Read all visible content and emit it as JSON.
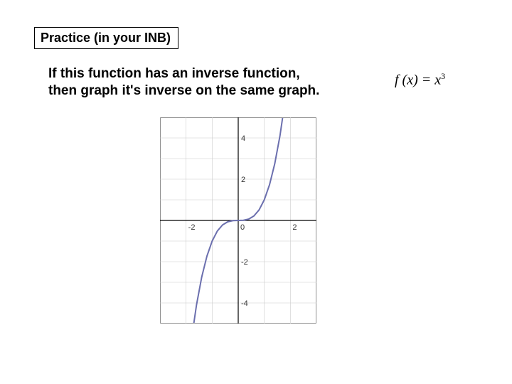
{
  "title": "Practice (in your INB)",
  "prompt_line1": "If this function has an inverse function,",
  "prompt_line2": "then graph it's inverse on the same graph.",
  "formula": {
    "lhs": "f (x)",
    "eq": " = ",
    "rhs_base": "x",
    "rhs_exp": "3"
  },
  "chart_data": {
    "type": "line",
    "title": "",
    "xlabel": "",
    "ylabel": "",
    "xlim": [
      -3,
      3
    ],
    "ylim": [
      -5,
      5
    ],
    "x_ticks": [
      -2,
      0,
      2
    ],
    "y_ticks": [
      -4,
      -2,
      2,
      4
    ],
    "grid": true,
    "series": [
      {
        "name": "f(x) = x^3",
        "color": "#6b6fae",
        "x": [
          -2.0,
          -1.8,
          -1.6,
          -1.4,
          -1.2,
          -1.0,
          -0.8,
          -0.6,
          -0.4,
          -0.2,
          0.0,
          0.2,
          0.4,
          0.6,
          0.8,
          1.0,
          1.2,
          1.4,
          1.6,
          1.8,
          2.0
        ],
        "y": [
          -8.0,
          -5.832,
          -4.096,
          -2.744,
          -1.728,
          -1.0,
          -0.512,
          -0.216,
          -0.064,
          -0.008,
          0.0,
          0.008,
          0.064,
          0.216,
          0.512,
          1.0,
          1.728,
          2.744,
          4.096,
          5.832,
          8.0
        ]
      }
    ]
  }
}
